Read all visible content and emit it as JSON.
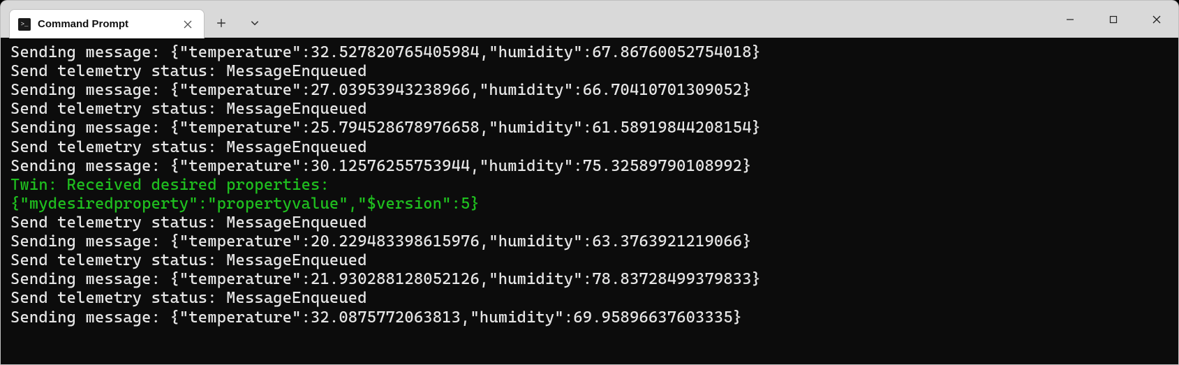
{
  "window": {
    "tab_title": "Command Prompt"
  },
  "output_lines": [
    {
      "text": "Sending message: {\"temperature\":32.527820765405984,\"humidity\":67.86760052754018}",
      "color": "white"
    },
    {
      "text": "Send telemetry status: MessageEnqueued",
      "color": "white"
    },
    {
      "text": "Sending message: {\"temperature\":27.03953943238966,\"humidity\":66.70410701309052}",
      "color": "white"
    },
    {
      "text": "Send telemetry status: MessageEnqueued",
      "color": "white"
    },
    {
      "text": "Sending message: {\"temperature\":25.794528678976658,\"humidity\":61.58919844208154}",
      "color": "white"
    },
    {
      "text": "Send telemetry status: MessageEnqueued",
      "color": "white"
    },
    {
      "text": "Sending message: {\"temperature\":30.12576255753944,\"humidity\":75.32589790108992}",
      "color": "white"
    },
    {
      "text": "Twin: Received desired properties:",
      "color": "green"
    },
    {
      "text": "{\"mydesiredproperty\":\"propertyvalue\",\"$version\":5}",
      "color": "green"
    },
    {
      "text": "Send telemetry status: MessageEnqueued",
      "color": "white"
    },
    {
      "text": "Sending message: {\"temperature\":20.229483398615976,\"humidity\":63.3763921219066}",
      "color": "white"
    },
    {
      "text": "Send telemetry status: MessageEnqueued",
      "color": "white"
    },
    {
      "text": "Sending message: {\"temperature\":21.930288128052126,\"humidity\":78.83728499379833}",
      "color": "white"
    },
    {
      "text": "Send telemetry status: MessageEnqueued",
      "color": "white"
    },
    {
      "text": "Sending message: {\"temperature\":32.0875772063813,\"humidity\":69.95896637603335}",
      "color": "white"
    }
  ]
}
